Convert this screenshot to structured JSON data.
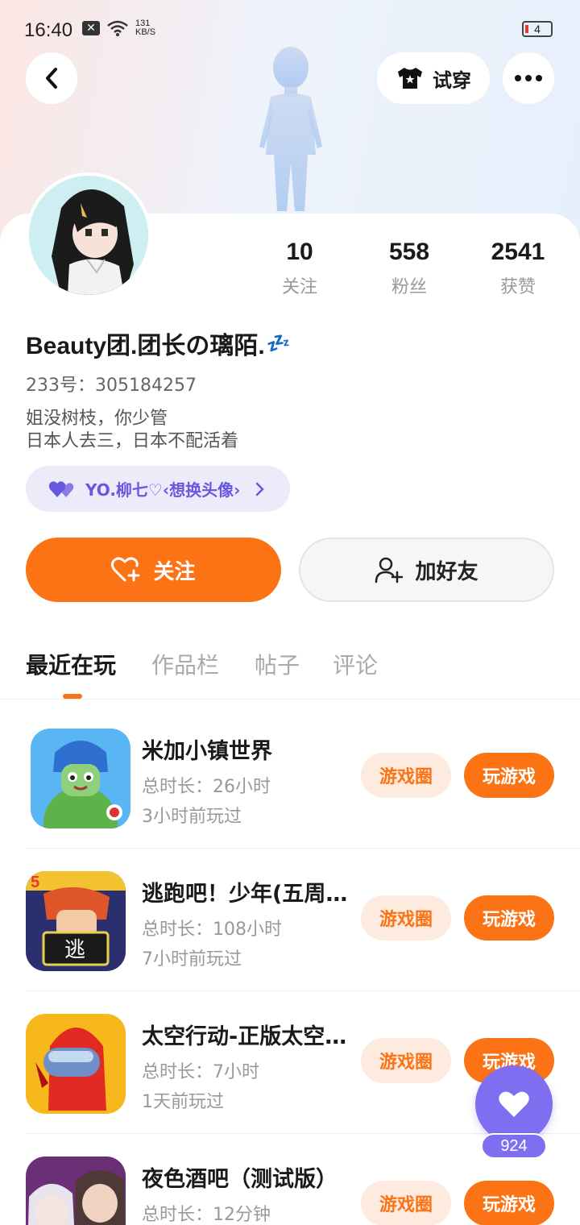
{
  "status_bar": {
    "time": "16:40",
    "net_speed_value": "131",
    "net_speed_unit": "KB/S",
    "battery_level": "4"
  },
  "header": {
    "try_on_label": "试穿"
  },
  "profile": {
    "name": "Beauty团.团长の璃陌.",
    "sleep_emoji": "💤",
    "id_line": "233号：305184257",
    "bio_lines": [
      "姐没树枝，你少管",
      "日本人去三，日本不配活着"
    ],
    "cp_tag": "YO.柳七♡‹想换头像›",
    "stats": [
      {
        "value": "10",
        "label": "关注"
      },
      {
        "value": "558",
        "label": "粉丝"
      },
      {
        "value": "2541",
        "label": "获赞"
      }
    ]
  },
  "actions": {
    "follow_label": "关注",
    "add_friend_label": "加好友"
  },
  "tabs": [
    "最近在玩",
    "作品栏",
    "帖子",
    "评论"
  ],
  "game_circle_label": "游戏圈",
  "play_label": "玩游戏",
  "games": [
    {
      "title": "米加小镇世界",
      "duration": "总时长：26小时",
      "last_played": "3小时前玩过"
    },
    {
      "title": "逃跑吧！少年(五周年庆)",
      "duration": "总时长：108小时",
      "last_played": "7小时前玩过"
    },
    {
      "title": "太空行动-正版太空狼人杀",
      "duration": "总时长：7小时",
      "last_played": "1天前玩过"
    },
    {
      "title": "夜色酒吧（测试版）",
      "duration": "总时长：12分钟",
      "last_played": ""
    }
  ],
  "like_fab": {
    "count": "924"
  },
  "colors": {
    "accent_orange": "#fb7314",
    "accent_purple": "#7f6ff0"
  }
}
